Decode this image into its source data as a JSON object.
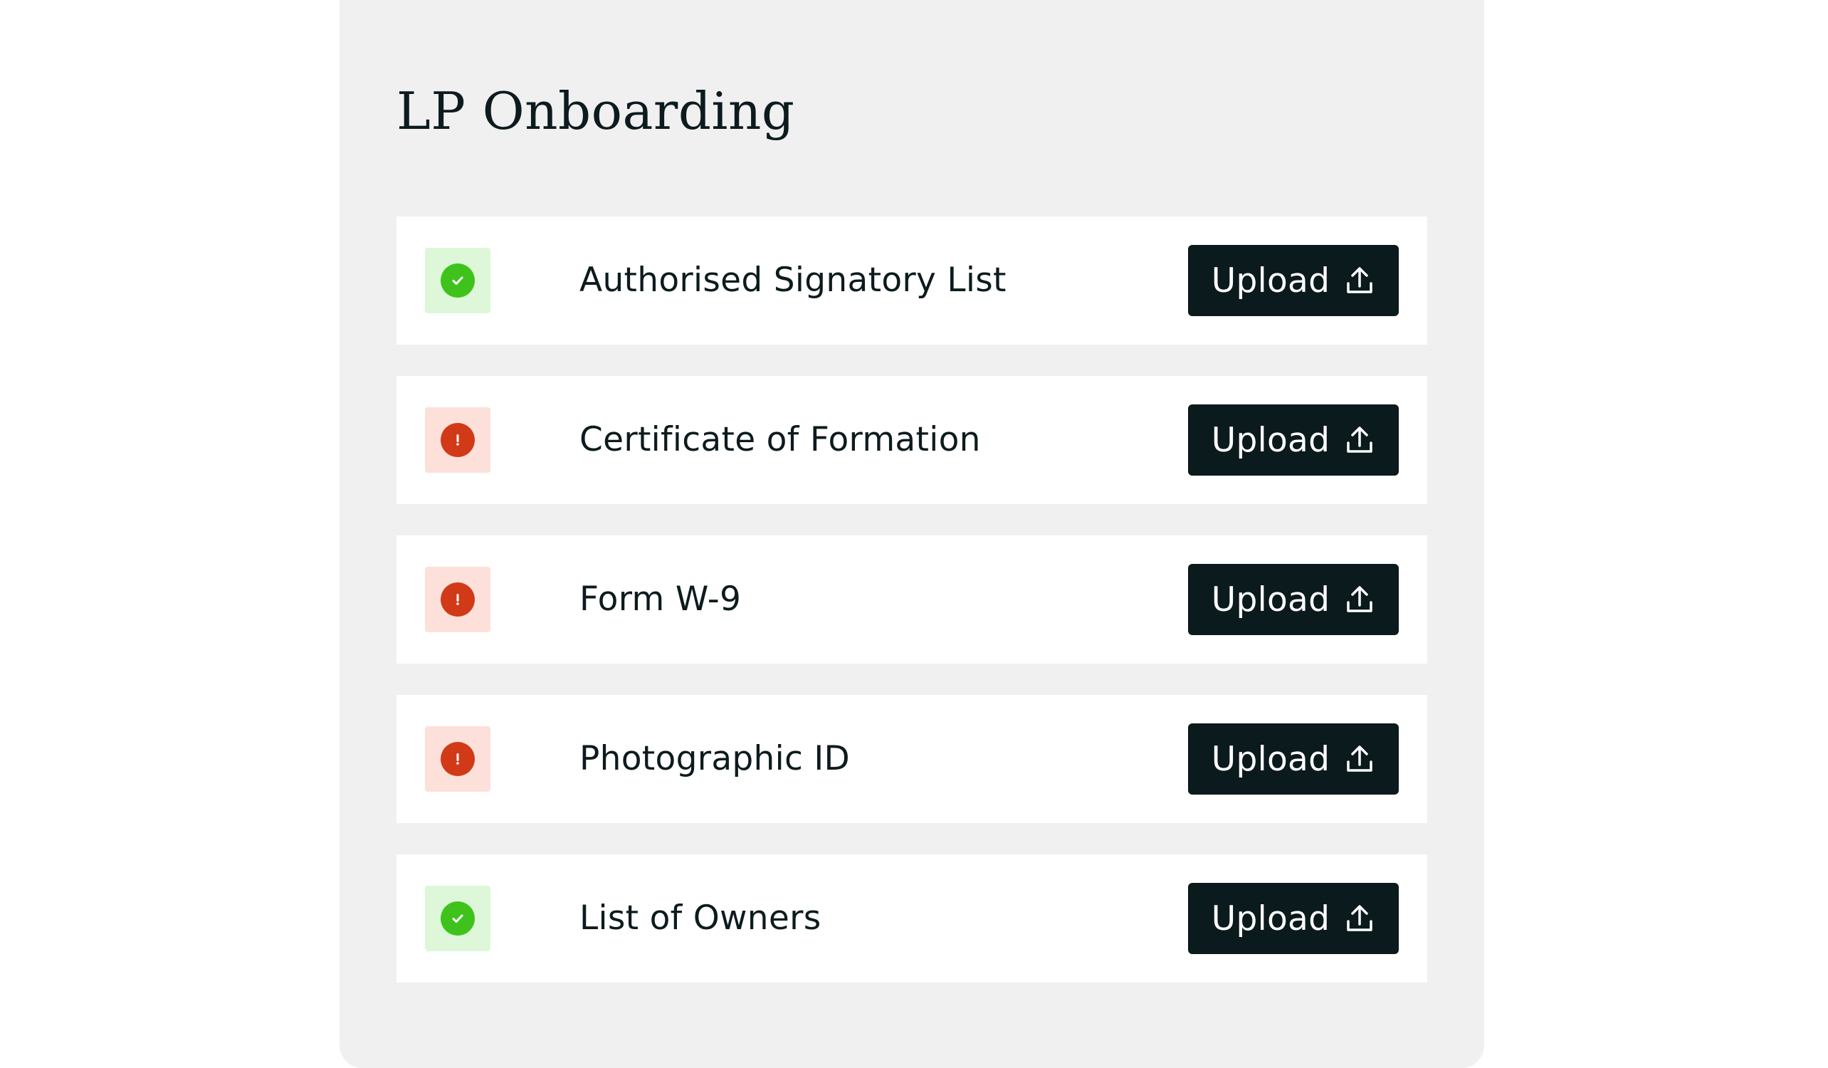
{
  "card": {
    "title": "LP Onboarding"
  },
  "documents": [
    {
      "label": "Authorised Signatory List",
      "status": "complete",
      "action_label": "Upload",
      "action_icon": "upload-icon"
    },
    {
      "label": "Certificate of Formation",
      "status": "missing",
      "action_label": "Upload",
      "action_icon": "upload-icon"
    },
    {
      "label": "Form W-9",
      "status": "missing",
      "action_label": "Upload",
      "action_icon": "upload-icon"
    },
    {
      "label": "Photographic ID",
      "status": "missing",
      "action_label": "Upload",
      "action_icon": "upload-icon"
    },
    {
      "label": "List of Owners",
      "status": "complete",
      "action_label": "Upload",
      "action_icon": "upload-icon"
    }
  ],
  "status_icons": {
    "complete": "check-circle-icon",
    "missing": "exclamation-circle-icon"
  },
  "colors": {
    "panel_background": "#f0f0f0",
    "row_background": "#ffffff",
    "button_background": "#0b1a1c",
    "text": "#0d1b1e",
    "complete_accent": "#3fc31c",
    "complete_tint": "#ddf7d8",
    "missing_accent": "#d13a18",
    "missing_tint": "#fde0da"
  }
}
